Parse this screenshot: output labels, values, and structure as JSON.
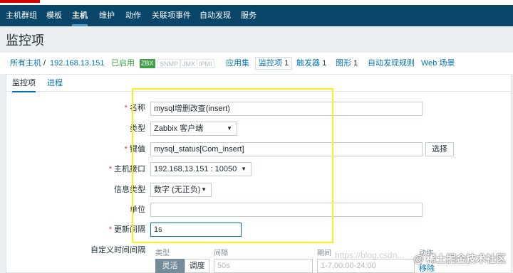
{
  "topnav": {
    "items": [
      "主机群组",
      "模板",
      "主机",
      "维护",
      "动作",
      "关联项事件",
      "自动发现",
      "服务"
    ],
    "active_index": 2
  },
  "page": {
    "title": "监控项"
  },
  "breadcrumb": {
    "all_hosts": "所有主机",
    "separator": "/",
    "host": "192.168.13.151",
    "status": "已启用",
    "badges": [
      "ZBX",
      "SNMP",
      "JMX",
      "IPMI"
    ],
    "links": [
      {
        "label": "应用集",
        "count": ""
      },
      {
        "label": "监控项",
        "count": "1"
      },
      {
        "label": "触发器",
        "count": "1"
      },
      {
        "label": "图形",
        "count": "1"
      },
      {
        "label": "自动发现规则",
        "count": ""
      },
      {
        "label": "Web 场景",
        "count": ""
      }
    ]
  },
  "subtabs": [
    "监控项",
    "进程"
  ],
  "form": {
    "name_label": "名称",
    "name_value": "mysql增删改查(insert)",
    "type_label": "类型",
    "type_value": "Zabbix 客户端",
    "key_label": "键值",
    "key_value": "mysql_status[Com_insert]",
    "select_button": "选择",
    "interface_label": "主机接口",
    "interface_value": "192.168.13.151 : 10050",
    "info_type_label": "信息类型",
    "info_type_value": "数字 (无正负)",
    "units_label": "单位",
    "units_value": "",
    "interval_label": "更新间隔",
    "interval_value": "1s",
    "custom_label": "自定义时间间隔",
    "custom_headers": [
      "类型",
      "间隔",
      "期间",
      "动作"
    ],
    "custom_type_options": [
      "灵活",
      "调度"
    ],
    "custom_interval_placeholder": "50s",
    "custom_period_placeholder": "1-7,00:00-24:00",
    "custom_action": "移除"
  },
  "watermark": {
    "url": "https://blog.csdn...",
    "brand": "稀土掘金技术社区",
    "at": "@"
  },
  "colors": {
    "nav": "#0a466a",
    "link": "#0275b8",
    "green": "#429e47",
    "required": "#e33734",
    "highlight": "#f5f120"
  }
}
